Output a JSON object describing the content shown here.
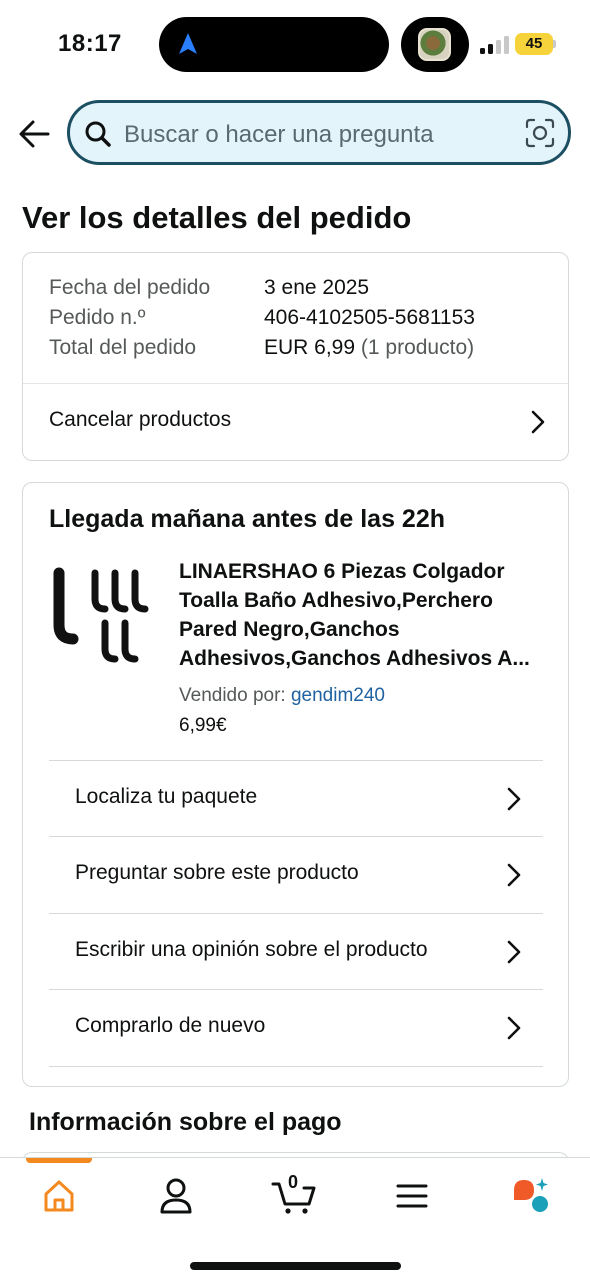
{
  "status_bar": {
    "time": "18:17",
    "battery": "45"
  },
  "search": {
    "placeholder": "Buscar o hacer una pregunta"
  },
  "page": {
    "title": "Ver los detalles del pedido"
  },
  "order_summary": {
    "rows": [
      {
        "label": "Fecha del pedido",
        "value": "3 ene 2025"
      },
      {
        "label": "Pedido n.º",
        "value": "406-4102505-5681153"
      },
      {
        "label": "Total del pedido",
        "value": "EUR 6,99",
        "note": "(1 producto)"
      }
    ],
    "cancel_label": "Cancelar productos"
  },
  "delivery": {
    "title": "Llegada mañana antes de las 22h",
    "product": {
      "title": "LINAERSHAO 6 Piezas Colgador Toalla Baño Adhesivo,Perchero Pared Negro,Ganchos Adhesivos,Ganchos Adhesivos A...",
      "sold_by_label": "Vendido por:",
      "seller": "gendim240",
      "price": "6,99€"
    },
    "actions": [
      {
        "label": "Localiza tu paquete"
      },
      {
        "label": "Preguntar sobre este producto"
      },
      {
        "label": "Escribir una opinión sobre el producto"
      },
      {
        "label": "Comprarlo de nuevo"
      }
    ]
  },
  "payment": {
    "title": "Información sobre el pago"
  },
  "bottom_nav": {
    "cart_count": "0",
    "items": [
      "home-icon",
      "account-icon",
      "cart-icon",
      "menu-icon",
      "assistant-icon"
    ]
  },
  "colors": {
    "accent_orange": "#f48a1f",
    "search_border": "#1d4f63",
    "search_bg": "#e3f4fb",
    "link_blue": "#2162a1",
    "assistant_orange": "#f05a28",
    "assistant_teal": "#1aa0b8"
  }
}
